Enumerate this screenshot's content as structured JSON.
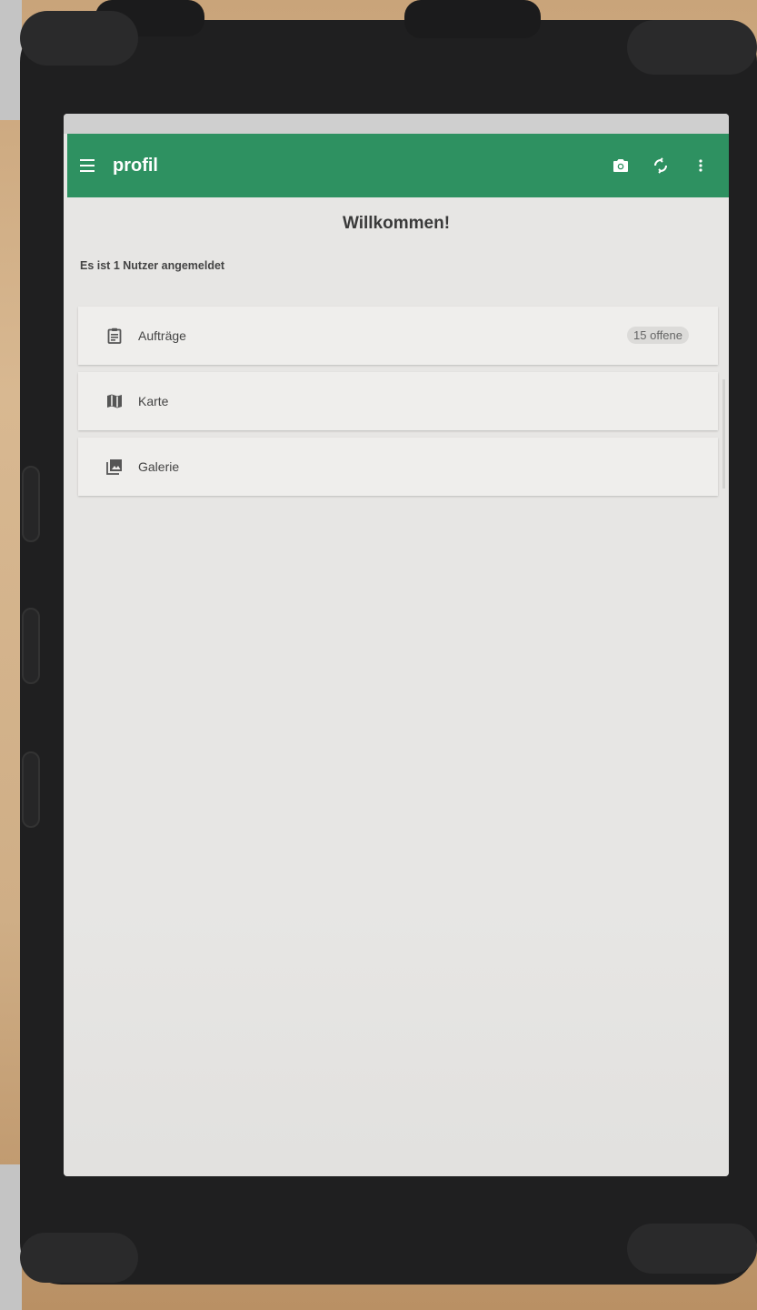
{
  "appbar": {
    "title": "profil",
    "menu_icon": "hamburger-menu-icon",
    "actions": [
      "camera-icon",
      "sync-icon",
      "more-vert-icon"
    ],
    "color": "#2e9161"
  },
  "main": {
    "welcome": "Willkommen!",
    "users_status": "Es ist 1 Nutzer angemeldet"
  },
  "menu": {
    "items": [
      {
        "label": "Aufträge",
        "icon": "clipboard-icon",
        "badge": "15 offene"
      },
      {
        "label": "Karte",
        "icon": "map-icon"
      },
      {
        "label": "Galerie",
        "icon": "gallery-icon"
      }
    ]
  }
}
